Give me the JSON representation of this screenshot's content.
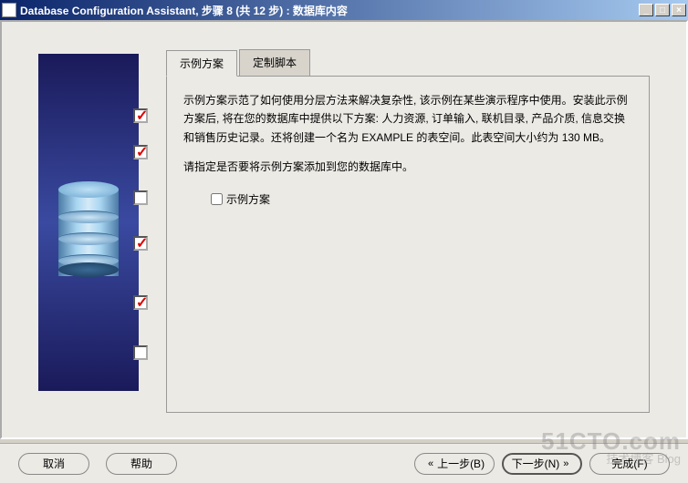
{
  "window": {
    "title": "Database Configuration Assistant, 步骤 8 (共 12 步) : 数据库内容"
  },
  "sidebar": {
    "steps": [
      {
        "checked": true
      },
      {
        "checked": true
      },
      {
        "checked": false
      },
      {
        "checked": true
      },
      {
        "checked": true
      },
      {
        "checked": false
      }
    ]
  },
  "tabs": {
    "active": "示例方案",
    "inactive": "定制脚本"
  },
  "content": {
    "paragraph1": "示例方案示范了如何使用分层方法来解决复杂性, 该示例在某些演示程序中使用。安装此示例方案后, 将在您的数据库中提供以下方案: 人力资源, 订单输入, 联机目录, 产品介质, 信息交换和销售历史记录。还将创建一个名为 EXAMPLE 的表空间。此表空间大小约为 130 MB。",
    "paragraph2": "请指定是否要将示例方案添加到您的数据库中。",
    "checkbox_label": "示例方案"
  },
  "buttons": {
    "cancel": "取消",
    "help": "帮助",
    "back": "上一步(B)",
    "next": "下一步(N)",
    "finish": "完成(F)"
  },
  "watermark": {
    "main": "51CTO.com",
    "sub": "技术博客 Blog"
  }
}
